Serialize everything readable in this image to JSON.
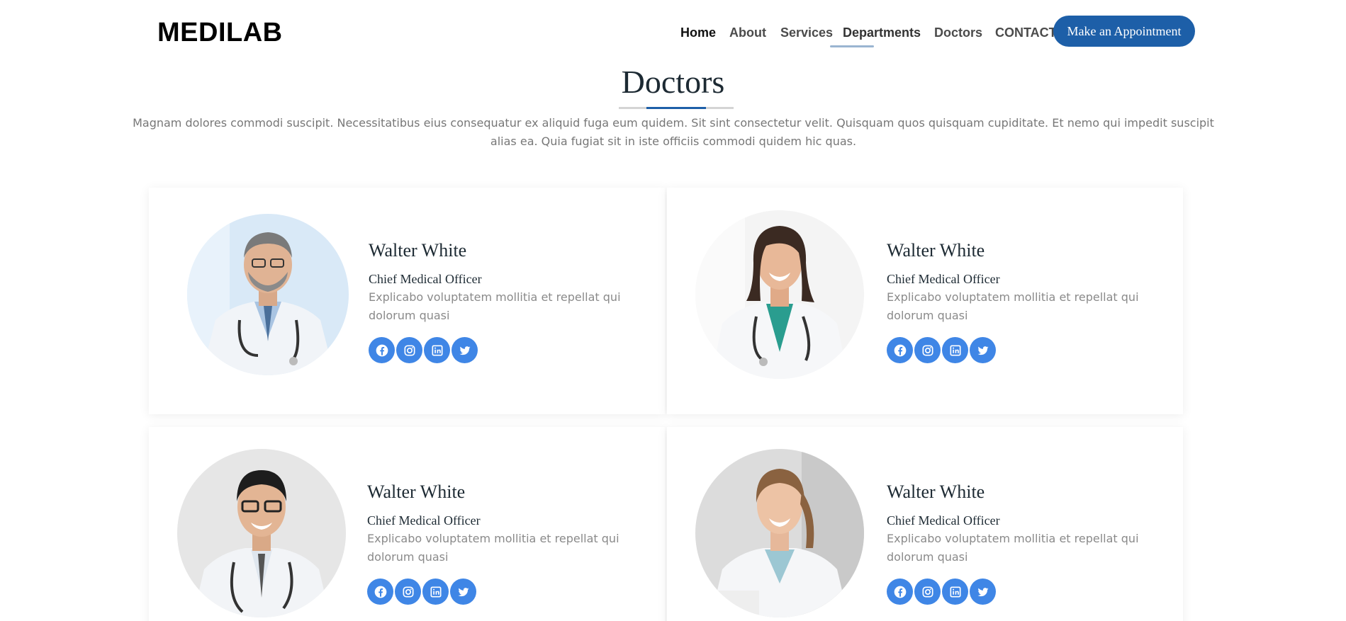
{
  "header": {
    "logo": "MEDILAB",
    "nav": [
      "Home",
      "About",
      "Services",
      "Departments",
      "Doctors",
      "CONTACT"
    ],
    "appointment_button": "Make an Appointment"
  },
  "section": {
    "title": "Doctors",
    "description": "Magnam dolores commodi suscipit. Necessitatibus eius consequatur ex aliquid fuga eum quidem. Sit sint consectetur velit. Quisquam quos quisquam cupiditate. Et nemo qui impedit suscipit alias ea. Quia fugiat sit in iste officiis commodi quidem hic quas."
  },
  "doctors": [
    {
      "name": "Walter White",
      "role": "Chief Medical Officer",
      "bio": "Explicabo voluptatem mollitia et repellat qui dolorum quasi",
      "photo": "male-doctor-grey-hair-photo"
    },
    {
      "name": "Walter White",
      "role": "Chief Medical Officer",
      "bio": "Explicabo voluptatem mollitia et repellat qui dolorum quasi",
      "photo": "female-doctor-dark-hair-photo"
    },
    {
      "name": "Walter White",
      "role": "Chief Medical Officer",
      "bio": "Explicabo voluptatem mollitia et repellat qui dolorum quasi",
      "photo": "male-doctor-glasses-photo"
    },
    {
      "name": "Walter White",
      "role": "Chief Medical Officer",
      "bio": "Explicabo voluptatem mollitia et repellat qui dolorum quasi",
      "photo": "female-doctor-blonde-photo"
    }
  ],
  "social_icons": [
    "facebook-icon",
    "instagram-icon",
    "linkedin-icon",
    "twitter-icon"
  ],
  "colors": {
    "brand": "#1d5fa8",
    "social": "#3f86e6",
    "heading": "#1d2a33",
    "muted": "#777777"
  }
}
